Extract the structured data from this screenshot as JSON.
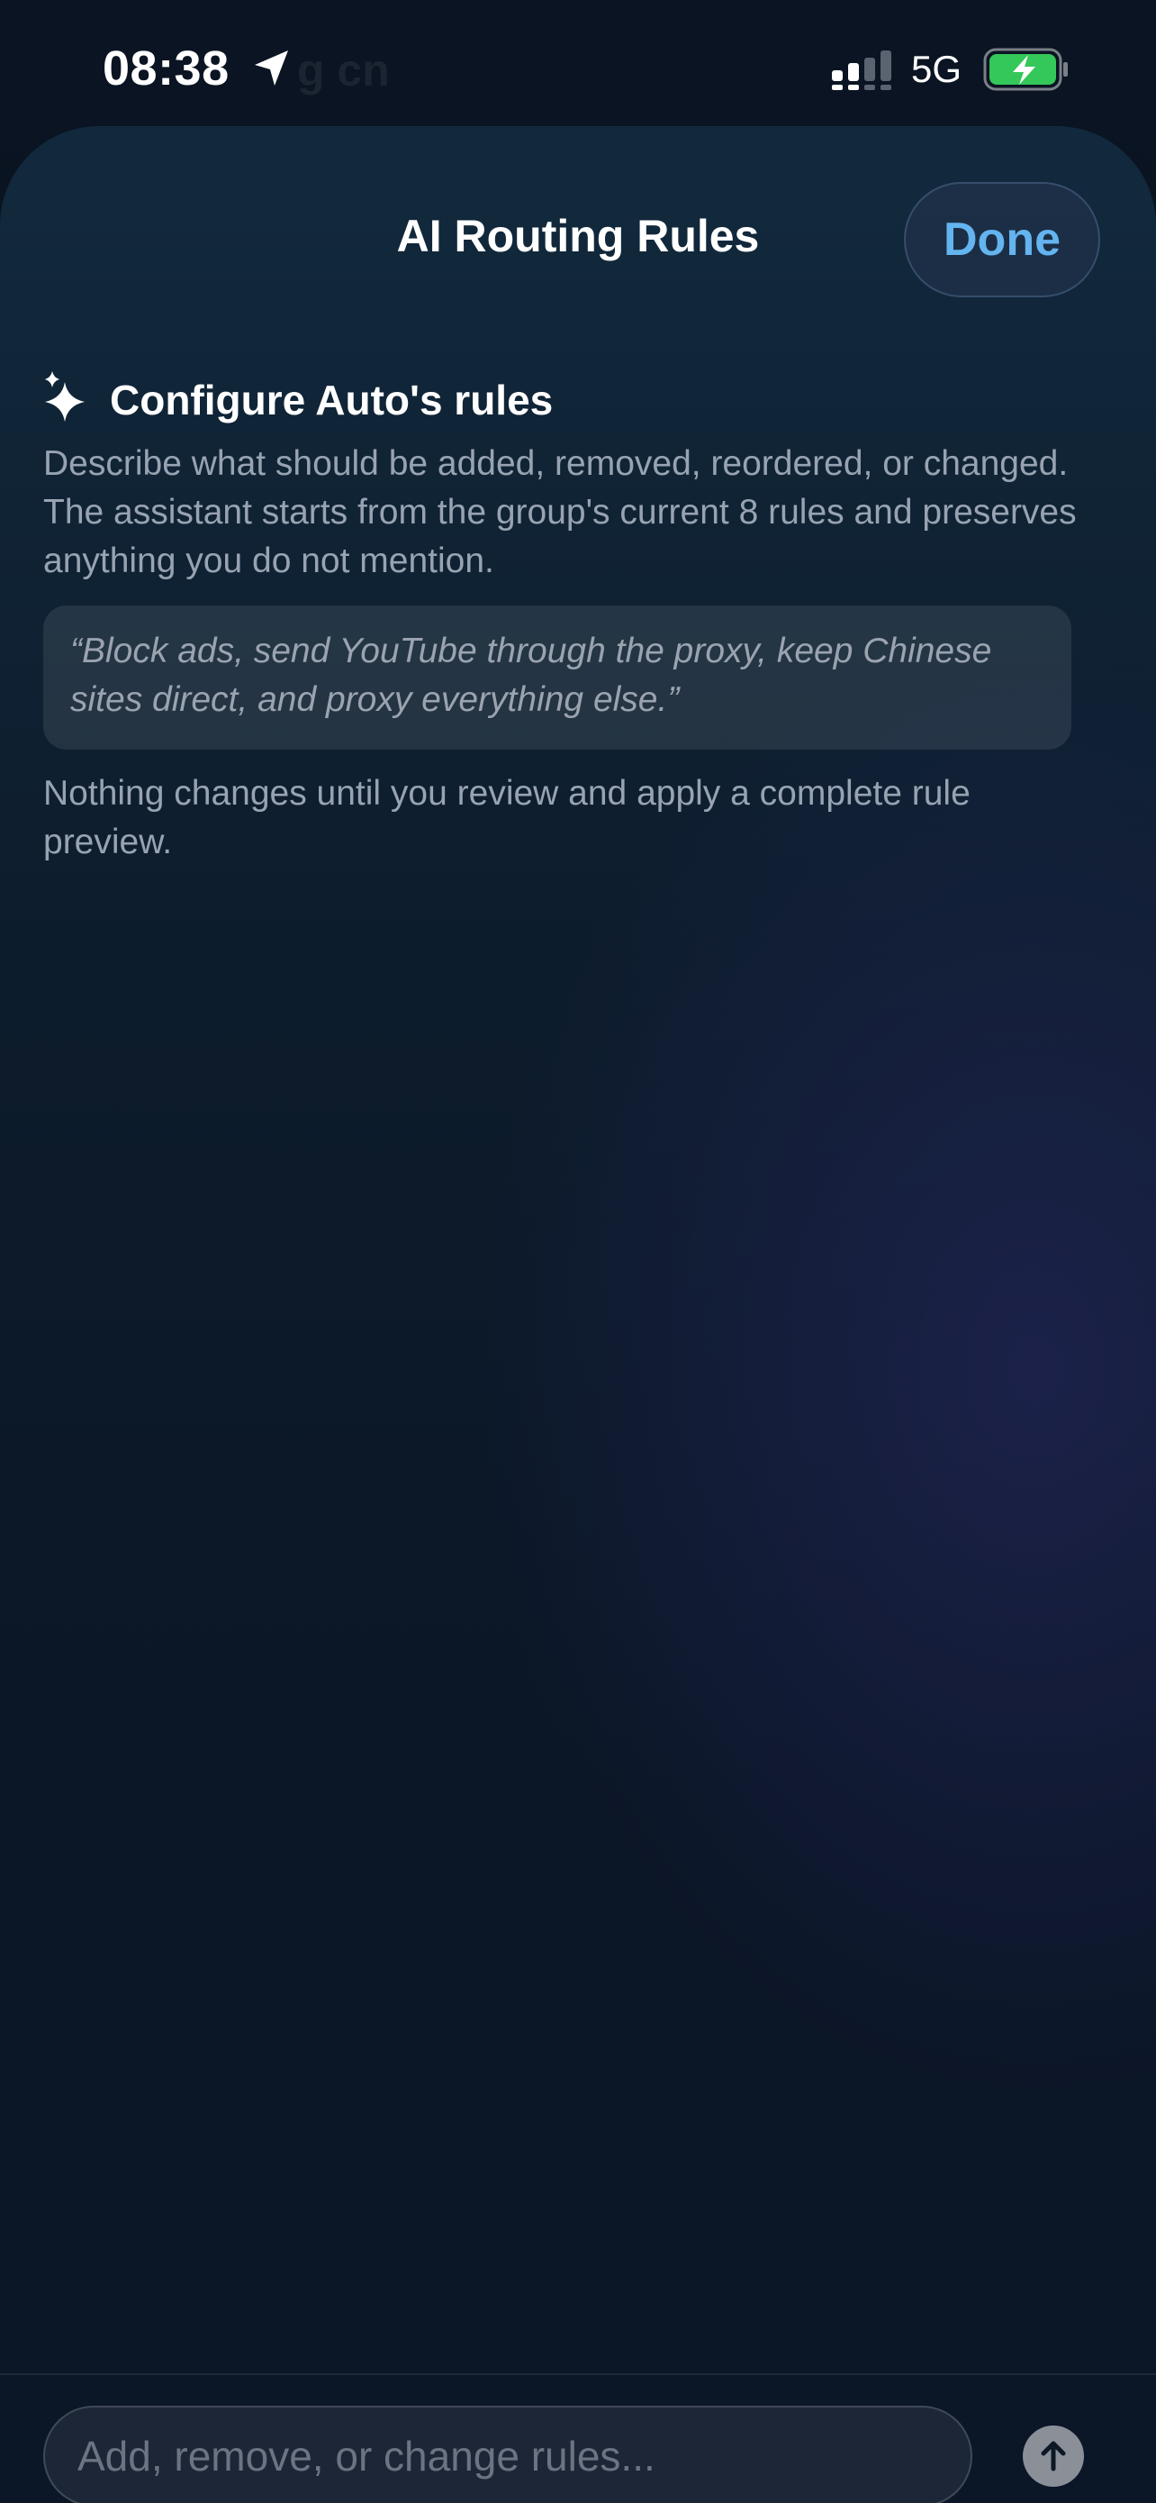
{
  "status_bar": {
    "time": "08:38",
    "background_text": "g cn",
    "network": "5G",
    "icons": [
      "location-arrow-icon",
      "cellular-signal-icon",
      "battery-charging-icon"
    ]
  },
  "sheet": {
    "title": "AI Routing Rules",
    "done_label": "Done",
    "section_icon": "sparkle-icon",
    "section_title": "Configure Auto's rules",
    "description": "Describe what should be added, removed, reordered, or changed. The assistant starts from the group's current 8 rules and preserves anything you do not mention.",
    "example": "“Block ads, send YouTube through the proxy, keep Chinese sites direct, and proxy everything else.”",
    "note": "Nothing changes until you review and apply a complete rule preview."
  },
  "composer": {
    "placeholder": "Add, remove, or change rules...",
    "value": "",
    "send_icon": "arrow-up-icon"
  },
  "colors": {
    "accent": "#63b4ef",
    "battery": "#34c759",
    "secondary_text": "#98a3b2"
  }
}
